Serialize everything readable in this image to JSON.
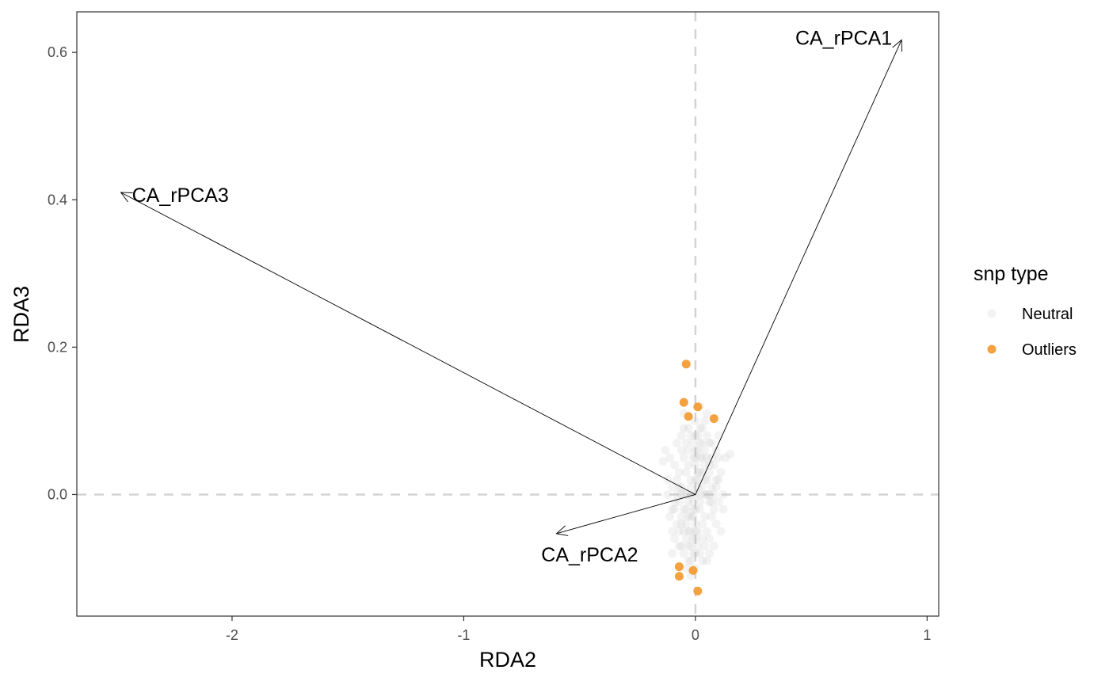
{
  "chart_data": {
    "type": "scatter",
    "xlabel": "RDA2",
    "ylabel": "RDA3",
    "xlim": [
      -2.67,
      1.05
    ],
    "ylim": [
      -0.165,
      0.655
    ],
    "xticks": [
      -2,
      -1,
      0,
      1
    ],
    "xtick_labels": [
      "-2",
      "-1",
      "0",
      "1"
    ],
    "yticks": [
      0.0,
      0.2,
      0.4,
      0.6
    ],
    "ytick_labels": [
      "0.0",
      "0.2",
      "0.4",
      "0.6"
    ],
    "grid": false,
    "reference_lines": {
      "x": 0,
      "y": 0,
      "style": "dashed",
      "color": "#d3d3d3"
    },
    "legend": {
      "title": "snp type",
      "placement": "right",
      "entries": [
        {
          "label": "Neutral",
          "color": "#bebebe",
          "opacity": 0.18
        },
        {
          "label": "Outliers",
          "color": "#f39c35",
          "opacity": 0.95
        }
      ]
    },
    "vectors": [
      {
        "label": "CA_rPCA1",
        "x": 0.89,
        "y": 0.617
      },
      {
        "label": "CA_rPCA2",
        "x": -0.6,
        "y": -0.053
      },
      {
        "label": "CA_rPCA3",
        "x": -2.48,
        "y": 0.41
      }
    ],
    "series": [
      {
        "name": "Outliers",
        "color": "#f39c35",
        "points": [
          {
            "x": -0.04,
            "y": 0.177
          },
          {
            "x": -0.05,
            "y": 0.125
          },
          {
            "x": 0.01,
            "y": 0.119
          },
          {
            "x": -0.03,
            "y": 0.106
          },
          {
            "x": 0.08,
            "y": 0.103
          },
          {
            "x": -0.07,
            "y": -0.098
          },
          {
            "x": -0.01,
            "y": -0.103
          },
          {
            "x": -0.07,
            "y": -0.111
          },
          {
            "x": 0.01,
            "y": -0.131
          }
        ]
      },
      {
        "name": "Neutral",
        "color": "#bebebe",
        "points": [
          {
            "x": 0.0,
            "y": 0.0
          },
          {
            "x": -0.02,
            "y": 0.01
          },
          {
            "x": 0.02,
            "y": -0.01
          },
          {
            "x": 0.01,
            "y": 0.02
          },
          {
            "x": -0.01,
            "y": -0.02
          },
          {
            "x": 0.03,
            "y": 0.03
          },
          {
            "x": -0.03,
            "y": -0.03
          },
          {
            "x": 0.04,
            "y": 0.0
          },
          {
            "x": -0.04,
            "y": 0.0
          },
          {
            "x": 0.0,
            "y": 0.04
          },
          {
            "x": 0.0,
            "y": -0.04
          },
          {
            "x": 0.02,
            "y": 0.05
          },
          {
            "x": -0.02,
            "y": -0.05
          },
          {
            "x": 0.05,
            "y": 0.02
          },
          {
            "x": -0.05,
            "y": -0.02
          },
          {
            "x": 0.01,
            "y": 0.06
          },
          {
            "x": -0.01,
            "y": -0.06
          },
          {
            "x": 0.06,
            "y": -0.01
          },
          {
            "x": -0.06,
            "y": 0.01
          },
          {
            "x": 0.03,
            "y": -0.04
          },
          {
            "x": -0.03,
            "y": 0.04
          },
          {
            "x": 0.07,
            "y": 0.01
          },
          {
            "x": -0.07,
            "y": -0.01
          },
          {
            "x": 0.02,
            "y": 0.07
          },
          {
            "x": -0.02,
            "y": -0.07
          },
          {
            "x": 0.04,
            "y": 0.06
          },
          {
            "x": -0.04,
            "y": -0.06
          },
          {
            "x": 0.08,
            "y": 0.0
          },
          {
            "x": -0.08,
            "y": 0.0
          },
          {
            "x": 0.0,
            "y": 0.08
          },
          {
            "x": 0.0,
            "y": -0.08
          },
          {
            "x": 0.05,
            "y": -0.05
          },
          {
            "x": -0.05,
            "y": 0.05
          },
          {
            "x": 0.09,
            "y": 0.02
          },
          {
            "x": -0.09,
            "y": -0.02
          },
          {
            "x": 0.03,
            "y": 0.09
          },
          {
            "x": -0.03,
            "y": -0.09
          },
          {
            "x": 0.06,
            "y": 0.04
          },
          {
            "x": -0.06,
            "y": -0.04
          },
          {
            "x": 0.1,
            "y": -0.01
          },
          {
            "x": -0.1,
            "y": 0.01
          },
          {
            "x": 0.01,
            "y": 0.03
          },
          {
            "x": -0.01,
            "y": -0.03
          },
          {
            "x": 0.02,
            "y": -0.02
          },
          {
            "x": -0.02,
            "y": 0.02
          },
          {
            "x": 0.04,
            "y": 0.02
          },
          {
            "x": -0.04,
            "y": -0.02
          },
          {
            "x": 0.01,
            "y": -0.05
          },
          {
            "x": -0.01,
            "y": 0.05
          },
          {
            "x": 0.03,
            "y": 0.01
          },
          {
            "x": -0.03,
            "y": -0.01
          },
          {
            "x": 0.05,
            "y": 0.05
          },
          {
            "x": -0.05,
            "y": -0.05
          },
          {
            "x": 0.02,
            "y": 0.03
          },
          {
            "x": -0.02,
            "y": -0.03
          },
          {
            "x": 0.06,
            "y": 0.0
          },
          {
            "x": -0.06,
            "y": 0.0
          },
          {
            "x": 0.0,
            "y": 0.06
          },
          {
            "x": 0.0,
            "y": -0.06
          },
          {
            "x": 0.07,
            "y": -0.03
          },
          {
            "x": -0.07,
            "y": 0.03
          },
          {
            "x": 0.04,
            "y": -0.07
          },
          {
            "x": -0.04,
            "y": 0.07
          },
          {
            "x": 0.11,
            "y": 0.03
          },
          {
            "x": -0.11,
            "y": -0.03
          },
          {
            "x": 0.08,
            "y": 0.04
          },
          {
            "x": -0.08,
            "y": -0.04
          },
          {
            "x": 0.05,
            "y": 0.08
          },
          {
            "x": -0.05,
            "y": -0.08
          },
          {
            "x": 0.12,
            "y": 0.0
          },
          {
            "x": -0.12,
            "y": 0.0
          },
          {
            "x": 0.03,
            "y": -0.09
          },
          {
            "x": -0.03,
            "y": 0.09
          },
          {
            "x": 0.09,
            "y": -0.04
          },
          {
            "x": -0.09,
            "y": 0.04
          },
          {
            "x": 0.06,
            "y": -0.06
          },
          {
            "x": -0.06,
            "y": 0.06
          },
          {
            "x": 0.13,
            "y": 0.05
          },
          {
            "x": -0.14,
            "y": 0.045
          },
          {
            "x": 0.15,
            "y": 0.055
          },
          {
            "x": -0.13,
            "y": 0.06
          },
          {
            "x": 0.1,
            "y": 0.05
          },
          {
            "x": -0.1,
            "y": -0.05
          },
          {
            "x": 0.07,
            "y": 0.07
          },
          {
            "x": -0.07,
            "y": -0.07
          },
          {
            "x": 0.01,
            "y": 0.08
          },
          {
            "x": -0.01,
            "y": -0.08
          },
          {
            "x": 0.02,
            "y": 0.09
          },
          {
            "x": -0.02,
            "y": -0.09
          },
          {
            "x": 0.0,
            "y": 0.1
          },
          {
            "x": 0.0,
            "y": -0.1
          },
          {
            "x": 0.04,
            "y": 0.1
          },
          {
            "x": -0.04,
            "y": -0.1
          },
          {
            "x": 0.08,
            "y": -0.07
          },
          {
            "x": -0.08,
            "y": 0.07
          },
          {
            "x": 0.1,
            "y": 0.08
          },
          {
            "x": -0.1,
            "y": -0.08
          },
          {
            "x": 0.05,
            "y": 0.11
          },
          {
            "x": -0.05,
            "y": 0.11
          },
          {
            "x": 0.02,
            "y": 0.12
          },
          {
            "x": -0.02,
            "y": -0.11
          },
          {
            "x": 0.06,
            "y": 0.03
          },
          {
            "x": -0.06,
            "y": -0.03
          },
          {
            "x": 0.03,
            "y": 0.05
          },
          {
            "x": -0.03,
            "y": -0.05
          },
          {
            "x": 0.01,
            "y": 0.01
          },
          {
            "x": -0.01,
            "y": -0.01
          },
          {
            "x": 0.02,
            "y": 0.0
          },
          {
            "x": -0.02,
            "y": 0.0
          },
          {
            "x": 0.0,
            "y": 0.02
          },
          {
            "x": 0.0,
            "y": -0.02
          },
          {
            "x": 0.07,
            "y": 0.05
          },
          {
            "x": -0.07,
            "y": -0.05
          },
          {
            "x": 0.09,
            "y": 0.01
          },
          {
            "x": -0.09,
            "y": -0.01
          },
          {
            "x": 0.04,
            "y": -0.03
          },
          {
            "x": -0.04,
            "y": 0.03
          },
          {
            "x": 0.08,
            "y": -0.02
          },
          {
            "x": -0.08,
            "y": 0.02
          },
          {
            "x": 0.05,
            "y": 0.0
          },
          {
            "x": -0.05,
            "y": 0.0
          },
          {
            "x": 0.03,
            "y": 0.07
          },
          {
            "x": -0.03,
            "y": -0.07
          },
          {
            "x": 0.06,
            "y": -0.08
          },
          {
            "x": -0.06,
            "y": 0.08
          },
          {
            "x": 0.02,
            "y": -0.08
          },
          {
            "x": -0.02,
            "y": 0.08
          },
          {
            "x": 0.11,
            "y": -0.05
          },
          {
            "x": -0.11,
            "y": 0.05
          },
          {
            "x": 0.09,
            "y": 0.06
          },
          {
            "x": -0.09,
            "y": -0.06
          },
          {
            "x": 0.04,
            "y": 0.04
          },
          {
            "x": -0.04,
            "y": -0.04
          },
          {
            "x": 0.01,
            "y": -0.07
          },
          {
            "x": -0.01,
            "y": 0.07
          },
          {
            "x": 0.07,
            "y": -0.01
          },
          {
            "x": -0.07,
            "y": 0.01
          },
          {
            "x": 0.12,
            "y": -0.02
          },
          {
            "x": -0.12,
            "y": 0.02
          },
          {
            "x": 0.05,
            "y": -0.09
          },
          {
            "x": -0.05,
            "y": 0.09
          },
          {
            "x": 0.0,
            "y": 0.05
          },
          {
            "x": 0.0,
            "y": -0.05
          },
          {
            "x": 0.03,
            "y": -0.06
          },
          {
            "x": -0.03,
            "y": 0.06
          },
          {
            "x": 0.1,
            "y": 0.02
          },
          {
            "x": -0.1,
            "y": -0.02
          },
          {
            "x": 0.06,
            "y": 0.07
          },
          {
            "x": -0.06,
            "y": -0.07
          }
        ]
      }
    ]
  }
}
